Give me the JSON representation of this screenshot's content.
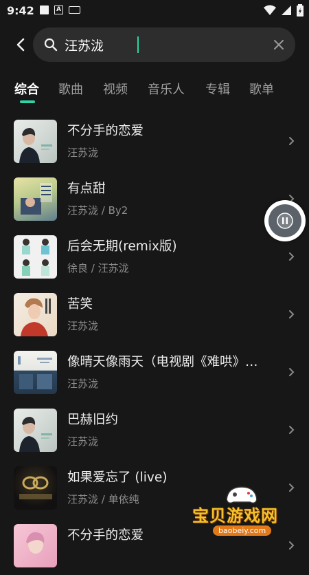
{
  "status_bar": {
    "time": "9:42",
    "keyboard_icon": "keyboard-icon",
    "a_icon": "A"
  },
  "search": {
    "value": "汪苏泷",
    "placeholder": ""
  },
  "tabs": [
    {
      "label": "综合",
      "active": true
    },
    {
      "label": "歌曲",
      "active": false
    },
    {
      "label": "视频",
      "active": false
    },
    {
      "label": "音乐人",
      "active": false
    },
    {
      "label": "专辑",
      "active": false
    },
    {
      "label": "歌单",
      "active": false
    }
  ],
  "songs": [
    {
      "title": "不分手的恋爱",
      "artist": "汪苏泷"
    },
    {
      "title": "有点甜",
      "artist": "汪苏泷 / By2"
    },
    {
      "title": "后会无期(remix版)",
      "artist": "徐良 / 汪苏泷"
    },
    {
      "title": "苦笑",
      "artist": "汪苏泷"
    },
    {
      "title": "像晴天像雨天（电视剧《难哄》…",
      "artist": "汪苏泷"
    },
    {
      "title": "巴赫旧约",
      "artist": "汪苏泷"
    },
    {
      "title": "如果爱忘了 (live)",
      "artist": "汪苏泷 / 单依纯"
    },
    {
      "title": "不分手的恋爱",
      "artist": ""
    }
  ],
  "watermark": {
    "text": "宝贝游戏网",
    "sub": "baobeiy.com"
  },
  "colors": {
    "accent": "#2ed4a5",
    "background": "#171717",
    "search_bg": "#2d2d2d"
  }
}
